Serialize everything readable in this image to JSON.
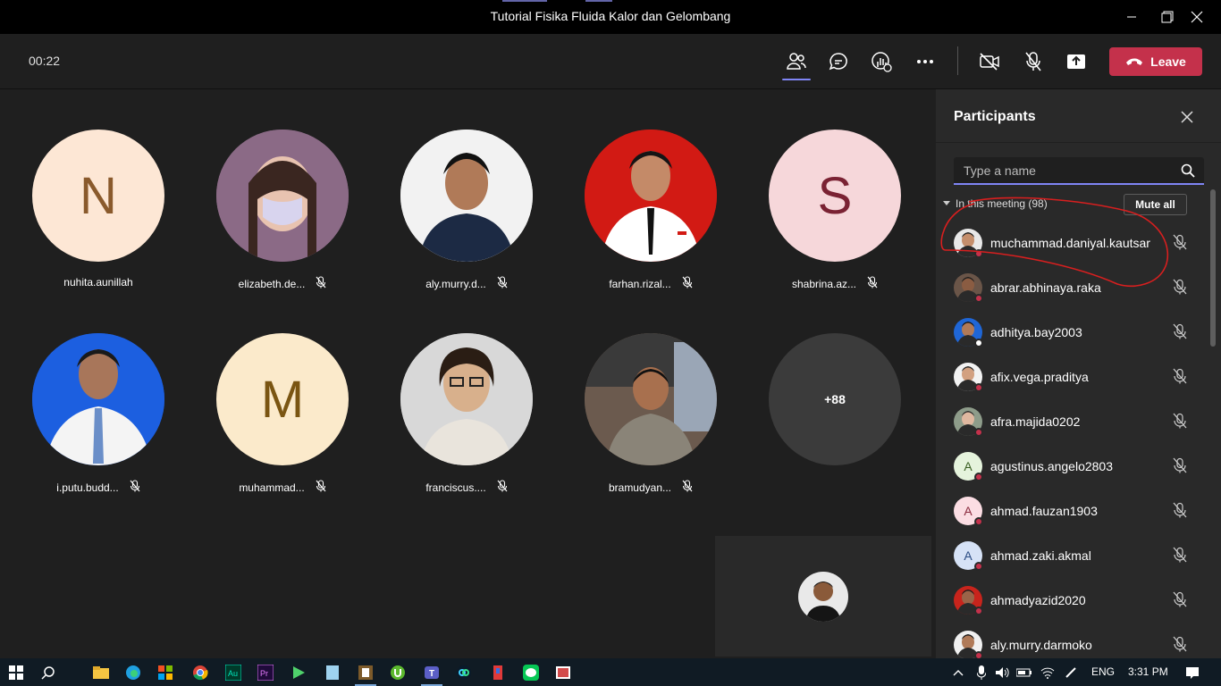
{
  "window": {
    "title": "Tutorial Fisika Fluida Kalor dan Gelombang",
    "minimize": "minimize",
    "maximize": "maximize",
    "close": "close"
  },
  "toolbar": {
    "timer": "00:22",
    "leave_label": "Leave",
    "buttons": [
      "participants-icon",
      "chat-icon",
      "raise-hand-icon",
      "more-icon",
      "camera-off-icon",
      "mic-off-icon",
      "share-icon"
    ]
  },
  "stage": {
    "tiles": [
      {
        "name": "nuhita.aunillah",
        "initial": "N",
        "bg": "#fde7d5",
        "fg": "#8a5a2c",
        "muted": false
      },
      {
        "name": "elizabeth.de...",
        "initial": "",
        "bg": "#8b6a86",
        "muted": true
      },
      {
        "name": "aly.murry.d...",
        "initial": "",
        "bg": "#f0f0f0",
        "muted": true
      },
      {
        "name": "farhan.rizal...",
        "initial": "",
        "bg": "#d21a14",
        "muted": true
      },
      {
        "name": "shabrina.az...",
        "initial": "S",
        "bg": "#f6d7da",
        "fg": "#7a2233",
        "muted": true
      },
      {
        "name": "i.putu.budd...",
        "initial": "",
        "bg": "#1c5fe0",
        "muted": true
      },
      {
        "name": "muhammad...",
        "initial": "M",
        "bg": "#fbeacb",
        "fg": "#7a5512",
        "muted": true
      },
      {
        "name": "franciscus....",
        "initial": "",
        "bg": "#d8d8d8",
        "muted": true
      },
      {
        "name": "bramudyan...",
        "initial": "",
        "bg": "#6b5a4e",
        "muted": true
      },
      {
        "name": "",
        "initial": "+88",
        "bg": "#3b3b3b",
        "fg": "#ffffff",
        "muted": false
      }
    ]
  },
  "panel": {
    "title": "Participants",
    "search_placeholder": "Type a name",
    "section_label": "In this meeting (98)",
    "mute_all": "Mute all",
    "participants": [
      {
        "name": "muchammad.daniyal.kautsar",
        "initial": "",
        "bg": "#e8e8e8",
        "status": "red"
      },
      {
        "name": "abrar.abhinaya.raka",
        "initial": "",
        "bg": "#6a5548",
        "status": "red"
      },
      {
        "name": "adhitya.bay2003",
        "initial": "",
        "bg": "#1f66d6",
        "status": "white"
      },
      {
        "name": "afix.vega.praditya",
        "initial": "",
        "bg": "#f2f2f2",
        "status": "red"
      },
      {
        "name": "afra.majida0202",
        "initial": "",
        "bg": "#8e9c8a",
        "status": "red"
      },
      {
        "name": "agustinus.angelo2803",
        "initial": "A",
        "bg": "#e5f3dc",
        "fg": "#3a5f22",
        "status": "red"
      },
      {
        "name": "ahmad.fauzan1903",
        "initial": "A",
        "bg": "#fbdde3",
        "fg": "#8a2a3e",
        "status": "red"
      },
      {
        "name": "ahmad.zaki.akmal",
        "initial": "A",
        "bg": "#d6e2f6",
        "fg": "#2a4b82",
        "status": "red"
      },
      {
        "name": "ahmadyazid2020",
        "initial": "",
        "bg": "#c8241c",
        "status": "red"
      },
      {
        "name": "aly.murry.darmoko",
        "initial": "",
        "bg": "#f0f0f0",
        "status": "red"
      }
    ]
  },
  "taskbar": {
    "language": "ENG",
    "time": "3:31 PM"
  }
}
